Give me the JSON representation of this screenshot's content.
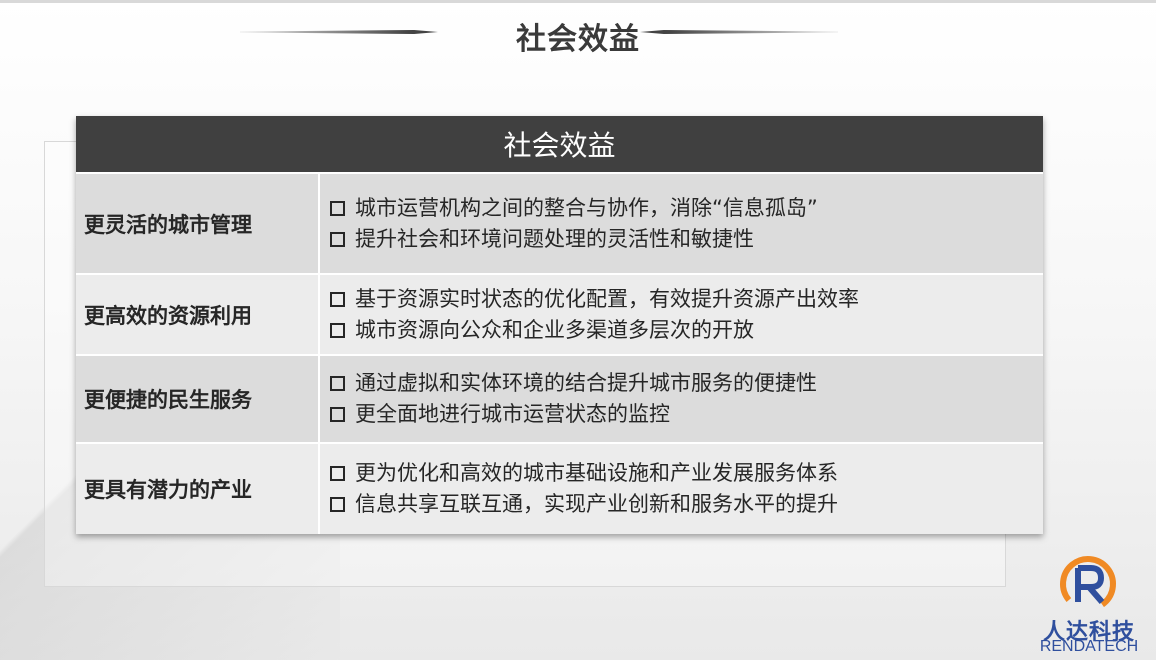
{
  "page_title": "社会效益",
  "table": {
    "header": "社会效益",
    "rows": [
      {
        "label": "更灵活的城市管理",
        "items": [
          "城市运营机构之间的整合与协作，消除“信息孤岛”",
          "提升社会和环境问题处理的灵活性和敏捷性"
        ]
      },
      {
        "label": "更高效的资源利用",
        "items": [
          "基于资源实时状态的优化配置，有效提升资源产出效率",
          "城市资源向公众和企业多渠道多层次的开放"
        ]
      },
      {
        "label": "更便捷的民生服务",
        "items": [
          "通过虚拟和实体环境的结合提升城市服务的便捷性",
          "更全面地进行城市运营状态的监控"
        ]
      },
      {
        "label": "更具有潜力的产业",
        "items": [
          "更为优化和高效的城市基础设施和产业发展服务体系",
          "信息共享互联互通，实现产业创新和服务水平的提升"
        ]
      }
    ]
  },
  "logo": {
    "cn": "人达科技",
    "en": "RENDATECH",
    "icon": "renda-logo-icon",
    "colors": {
      "orange": "#f08a24",
      "blue": "#2f4f9e"
    }
  }
}
